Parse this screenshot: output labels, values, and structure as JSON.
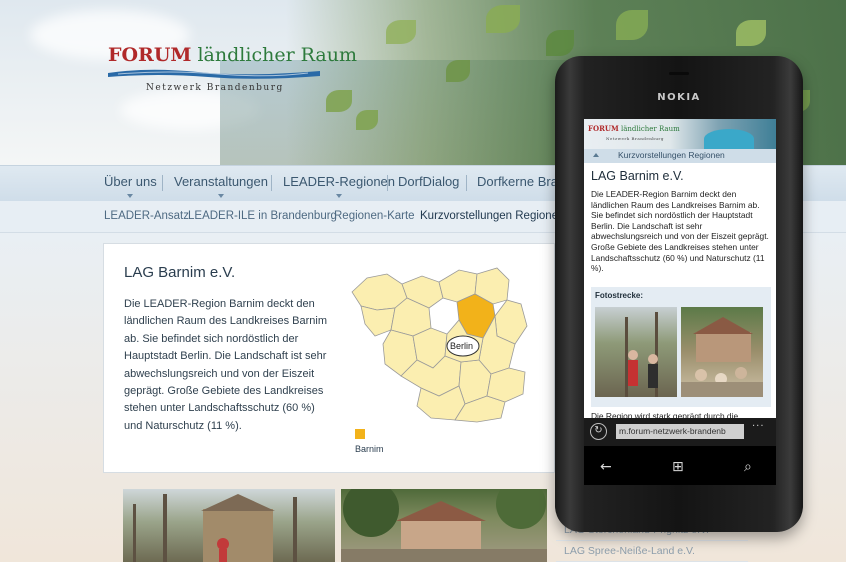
{
  "site": {
    "logo": {
      "title_forum": "FORUM",
      "title_rest": "ländlicher Raum",
      "subtitle": "Netzwerk Brandenburg"
    },
    "nav": [
      {
        "label": "Über uns"
      },
      {
        "label": "Veranstaltungen"
      },
      {
        "label": "LEADER-Regionen"
      },
      {
        "label": "DorfDialog"
      },
      {
        "label": "Dorfkerne Bran"
      }
    ],
    "subnav": [
      {
        "label": "LEADER-Ansatz"
      },
      {
        "label": "LEADER-ILE in Brandenburg"
      },
      {
        "label": "Regionen-Karte"
      },
      {
        "label": "Kurzvorstellungen Regionen"
      }
    ],
    "card": {
      "title": "LAG Barnim e.V.",
      "text": "Die LEADER-Region Barnim deckt den ländlichen Raum des Landkreises Barnim ab. Sie befindet sich nordöstlich der Hauptstadt Berlin. Die Landschaft ist sehr abwechslungsreich und von der Eiszeit geprägt. Große Gebiete des Landkreises stehen unter Landschaftsschutz (60 %) und Naturschutz (11 %)."
    },
    "map": {
      "city_label": "Berlin",
      "legend_label": "Barnim",
      "highlight_color": "#f2b21a",
      "region_color": "#fbeeb0"
    },
    "side_links": [
      {
        "label": "LAG Storchenland-Prignitz e.V."
      },
      {
        "label": "LAG Spree-Neiße-Land e.V."
      }
    ]
  },
  "phone": {
    "brand": "NOKIA",
    "mobile": {
      "logo_forum": "FORUM",
      "logo_rest": "ländlicher Raum",
      "logo_sub": "Netzwerk Brandenburg",
      "nav_label": "Kurzvorstellungen Regionen",
      "title": "LAG Barnim e.V.",
      "text": "Die LEADER-Region Barnim deckt den ländlichen Raum des Landkreises Barnim ab. Sie befindet sich nordöstlich der Hauptstadt Berlin. Die Landschaft ist sehr abwechslungsreich und von der Eiszeit geprägt. Große Gebiete des Landkreises stehen unter Landschaftsschutz (60 %) und Naturschutz (11 %).",
      "foto_label": "Fotostrecke:",
      "more_text": "Die Region wird stark geprägt durch die",
      "url": "m.forum-netzwerk-brandenb",
      "dots": "..."
    },
    "softkeys": {
      "back": "←",
      "windows": "⊞",
      "search": "⌕"
    }
  }
}
